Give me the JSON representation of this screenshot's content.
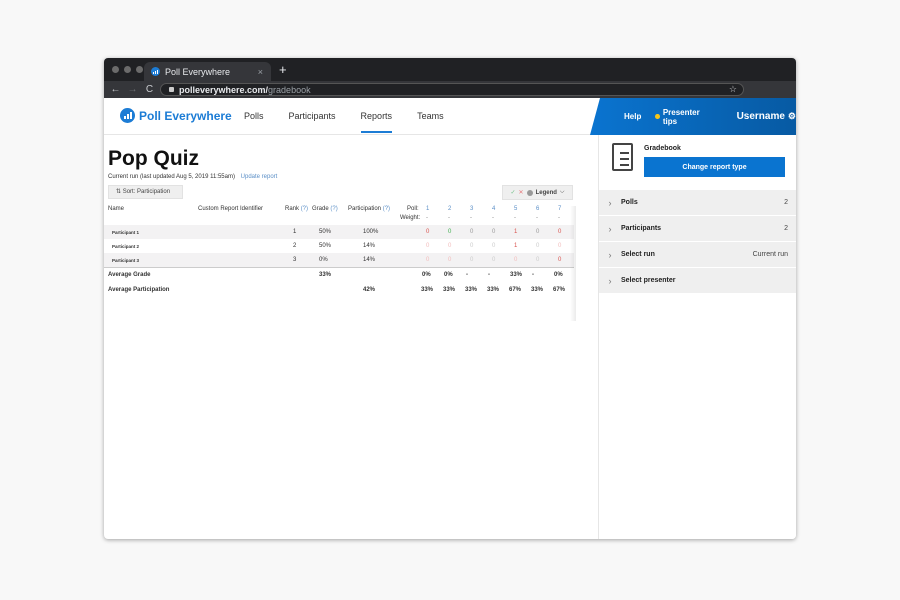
{
  "browser": {
    "tab_title": "Poll Everywhere",
    "tab_close": "×",
    "new_tab": "+",
    "url_host": "polleverywhere.com/",
    "url_path": "gradebook",
    "back": "←",
    "forward": "→",
    "reload": "C",
    "bookmark": "☆"
  },
  "header": {
    "brand": "Poll Everywhere",
    "nav": [
      {
        "label": "Polls",
        "active": false
      },
      {
        "label": "Participants",
        "active": false
      },
      {
        "label": "Reports",
        "active": true
      },
      {
        "label": "Teams",
        "active": false
      }
    ],
    "help": "Help",
    "presenter_tips": "Presenter tips",
    "username": "Username",
    "accent_color": "#0a74d0"
  },
  "report": {
    "title": "Pop Quiz",
    "run_info": "Current run (last updated Aug 5, 2019 11:55am)",
    "update_link": "Update report",
    "sort_label": "⇅ Sort: Participation",
    "legend_label": "Legend",
    "columns": {
      "name": "Name",
      "custom_id": "Custom Report Identifier",
      "rank": "Rank",
      "grade": "Grade",
      "participation": "Participation",
      "help_marker": "(?)",
      "poll": "Poll:",
      "weight": "Weight:"
    },
    "polls": [
      "1",
      "2",
      "3",
      "4",
      "5",
      "6",
      "7"
    ],
    "weights": [
      "-",
      "-",
      "-",
      "-",
      "-",
      "-",
      "-"
    ],
    "rows": [
      {
        "name": "Participant 1",
        "rank": "1",
        "grade": "50%",
        "participation": "100%",
        "scores": [
          "0",
          "0",
          "0",
          "0",
          "1",
          "0",
          "0"
        ],
        "states": [
          "red",
          "green",
          "grey",
          "grey",
          "red",
          "grey",
          "red"
        ]
      },
      {
        "name": "Participant 2",
        "rank": "2",
        "grade": "50%",
        "participation": "14%",
        "scores": [
          "0",
          "0",
          "0",
          "0",
          "1",
          "0",
          "0"
        ],
        "states": [
          "fred",
          "fred",
          "fgrey",
          "fgrey",
          "red",
          "fgrey",
          "fred"
        ]
      },
      {
        "name": "Participant 3",
        "rank": "3",
        "grade": "0%",
        "participation": "14%",
        "scores": [
          "0",
          "0",
          "0",
          "0",
          "0",
          "0",
          "0"
        ],
        "states": [
          "fred",
          "fred",
          "fgrey",
          "fgrey",
          "fred",
          "fgrey",
          "red"
        ]
      }
    ],
    "average_grade": {
      "label": "Average Grade",
      "grade": "33%",
      "per_poll": [
        "0%",
        "0%",
        "-",
        "-",
        "33%",
        "-",
        "0%"
      ]
    },
    "average_participation": {
      "label": "Average Participation",
      "participation": "42%",
      "per_poll": [
        "33%",
        "33%",
        "33%",
        "33%",
        "67%",
        "33%",
        "67%"
      ]
    }
  },
  "sidebar": {
    "report_type": "Gradebook",
    "change_button": "Change report type",
    "sections": [
      {
        "label": "Polls",
        "value": "2"
      },
      {
        "label": "Participants",
        "value": "2"
      },
      {
        "label": "Select run",
        "value": "Current run"
      },
      {
        "label": "Select presenter",
        "value": ""
      }
    ]
  }
}
